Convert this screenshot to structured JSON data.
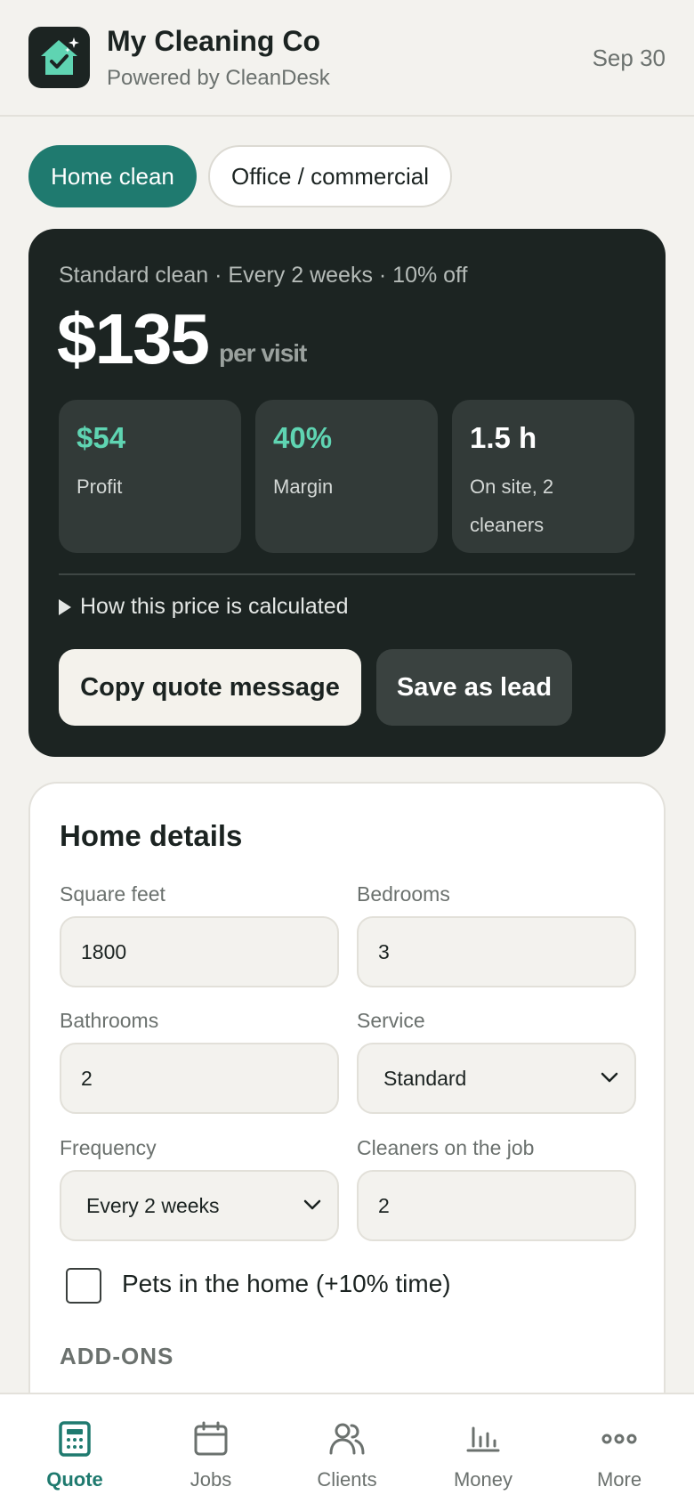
{
  "header": {
    "logo_icon": "house-check-icon",
    "brand_name": "My Cleaning Co",
    "brand_sub": "Powered by CleanDesk",
    "date": "Sep 30"
  },
  "tabs": [
    {
      "label": "Home clean",
      "active": true
    },
    {
      "label": "Office / commercial",
      "active": false
    }
  ],
  "quote": {
    "description": "Standard clean · Every 2 weeks · 10% off",
    "price": "$135",
    "per_visit": "per visit",
    "stats": [
      {
        "value": "$54",
        "label": "Profit"
      },
      {
        "value": "40%",
        "label": "Margin"
      },
      {
        "value": "1.5 h",
        "label": "On site, 2 cleaners"
      }
    ],
    "calc_link": "How this price is calculated",
    "copy_button": "Copy quote message",
    "lead_button": "Save as lead"
  },
  "details": {
    "title": "Home details",
    "square_feet": {
      "label": "Square feet",
      "value": "1800"
    },
    "bedrooms": {
      "label": "Bedrooms",
      "value": "3"
    },
    "bathrooms": {
      "label": "Bathrooms",
      "value": "2"
    },
    "service": {
      "label": "Service",
      "value": "Standard"
    },
    "frequency": {
      "label": "Frequency",
      "value": "Every 2 weeks"
    },
    "cleaners": {
      "label": "Cleaners on the job",
      "value": "2"
    },
    "pets": {
      "label": "Pets in the home (+10% time)",
      "checked": false
    },
    "addons_heading": "ADD-ONS"
  },
  "nav": [
    {
      "label": "Quote",
      "icon": "quote-document-icon",
      "active": true
    },
    {
      "label": "Jobs",
      "icon": "calendar-icon",
      "active": false
    },
    {
      "label": "Clients",
      "icon": "users-icon",
      "active": false
    },
    {
      "label": "Money",
      "icon": "bar-chart-icon",
      "active": false
    },
    {
      "label": "More",
      "icon": "more-dots-icon",
      "active": false
    }
  ],
  "colors": {
    "accent": "#1f7a6f",
    "dark_card": "#1c2422",
    "highlight_green": "#5fd4b2",
    "background": "#f3f2ee"
  }
}
